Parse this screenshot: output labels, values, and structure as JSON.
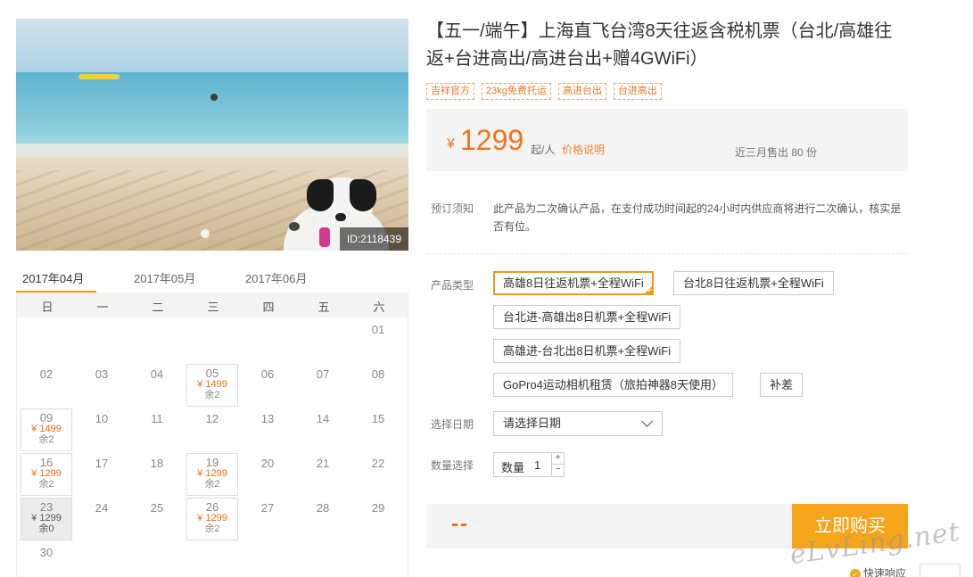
{
  "product": {
    "title": "【五一/端午】上海直飞台湾8天往返含税机票（台北/高雄往返+台进高出/高进台出+赠4GWiFi）",
    "tags": [
      "吉祥官方",
      "23kg免费托运",
      "高进台出",
      "台进高出"
    ],
    "image_id": "ID:2118439"
  },
  "price": {
    "currency": "¥",
    "amount": "1299",
    "per": "起/人",
    "explain_link": "价格说明",
    "sold_text": "近三月售出 80 份"
  },
  "notice": {
    "label": "预订须知",
    "text": "此产品为二次确认产品，在支付成功时间起的24小时内供应商将进行二次确认，核实是否有位。"
  },
  "product_type": {
    "label": "产品类型",
    "options": [
      "高雄8日往返机票+全程WiFi",
      "台北8日往返机票+全程WiFi",
      "台北进-高雄出8日机票+全程WiFi",
      "高雄进-台北出8日机票+全程WiFi",
      "GoPro4运动相机租赁（旅拍神器8天使用）",
      "补差"
    ],
    "selected_index": 0
  },
  "date_select": {
    "label": "选择日期",
    "placeholder": "请选择日期"
  },
  "quantity": {
    "label": "数量选择",
    "inner_label": "数量",
    "value": "1",
    "plus": "+",
    "minus": "−"
  },
  "buy": {
    "total": "--",
    "button": "立即购买"
  },
  "fast_response": "快速响应",
  "watermark": "eLvLing.net",
  "calendar": {
    "tabs": [
      "2017年04月",
      "2017年05月",
      "2017年06月"
    ],
    "active_tab": 0,
    "weekdays": [
      "日",
      "一",
      "二",
      "三",
      "四",
      "五",
      "六"
    ],
    "days": [
      {
        "d": "01"
      },
      {
        "d": "02"
      },
      {
        "d": "03"
      },
      {
        "d": "04"
      },
      {
        "d": "05",
        "price": "¥ 1499",
        "stock": "余2"
      },
      {
        "d": "06"
      },
      {
        "d": "07"
      },
      {
        "d": "08"
      },
      {
        "d": "09",
        "price": "¥ 1499",
        "stock": "余2"
      },
      {
        "d": "10"
      },
      {
        "d": "11"
      },
      {
        "d": "12"
      },
      {
        "d": "13"
      },
      {
        "d": "14"
      },
      {
        "d": "15"
      },
      {
        "d": "16",
        "price": "¥ 1299",
        "stock": "余2"
      },
      {
        "d": "17"
      },
      {
        "d": "18"
      },
      {
        "d": "19",
        "price": "¥ 1299",
        "stock": "余2"
      },
      {
        "d": "20"
      },
      {
        "d": "21"
      },
      {
        "d": "22"
      },
      {
        "d": "23",
        "price": "¥ 1299",
        "stock": "余0",
        "soldout": true
      },
      {
        "d": "24"
      },
      {
        "d": "25"
      },
      {
        "d": "26",
        "price": "¥ 1299",
        "stock": "余2"
      },
      {
        "d": "27"
      },
      {
        "d": "28"
      },
      {
        "d": "29"
      },
      {
        "d": "30"
      }
    ]
  },
  "colors": {
    "accent": "#f19a1a",
    "price": "#f26b11",
    "buy_button": "#f5a51b"
  }
}
